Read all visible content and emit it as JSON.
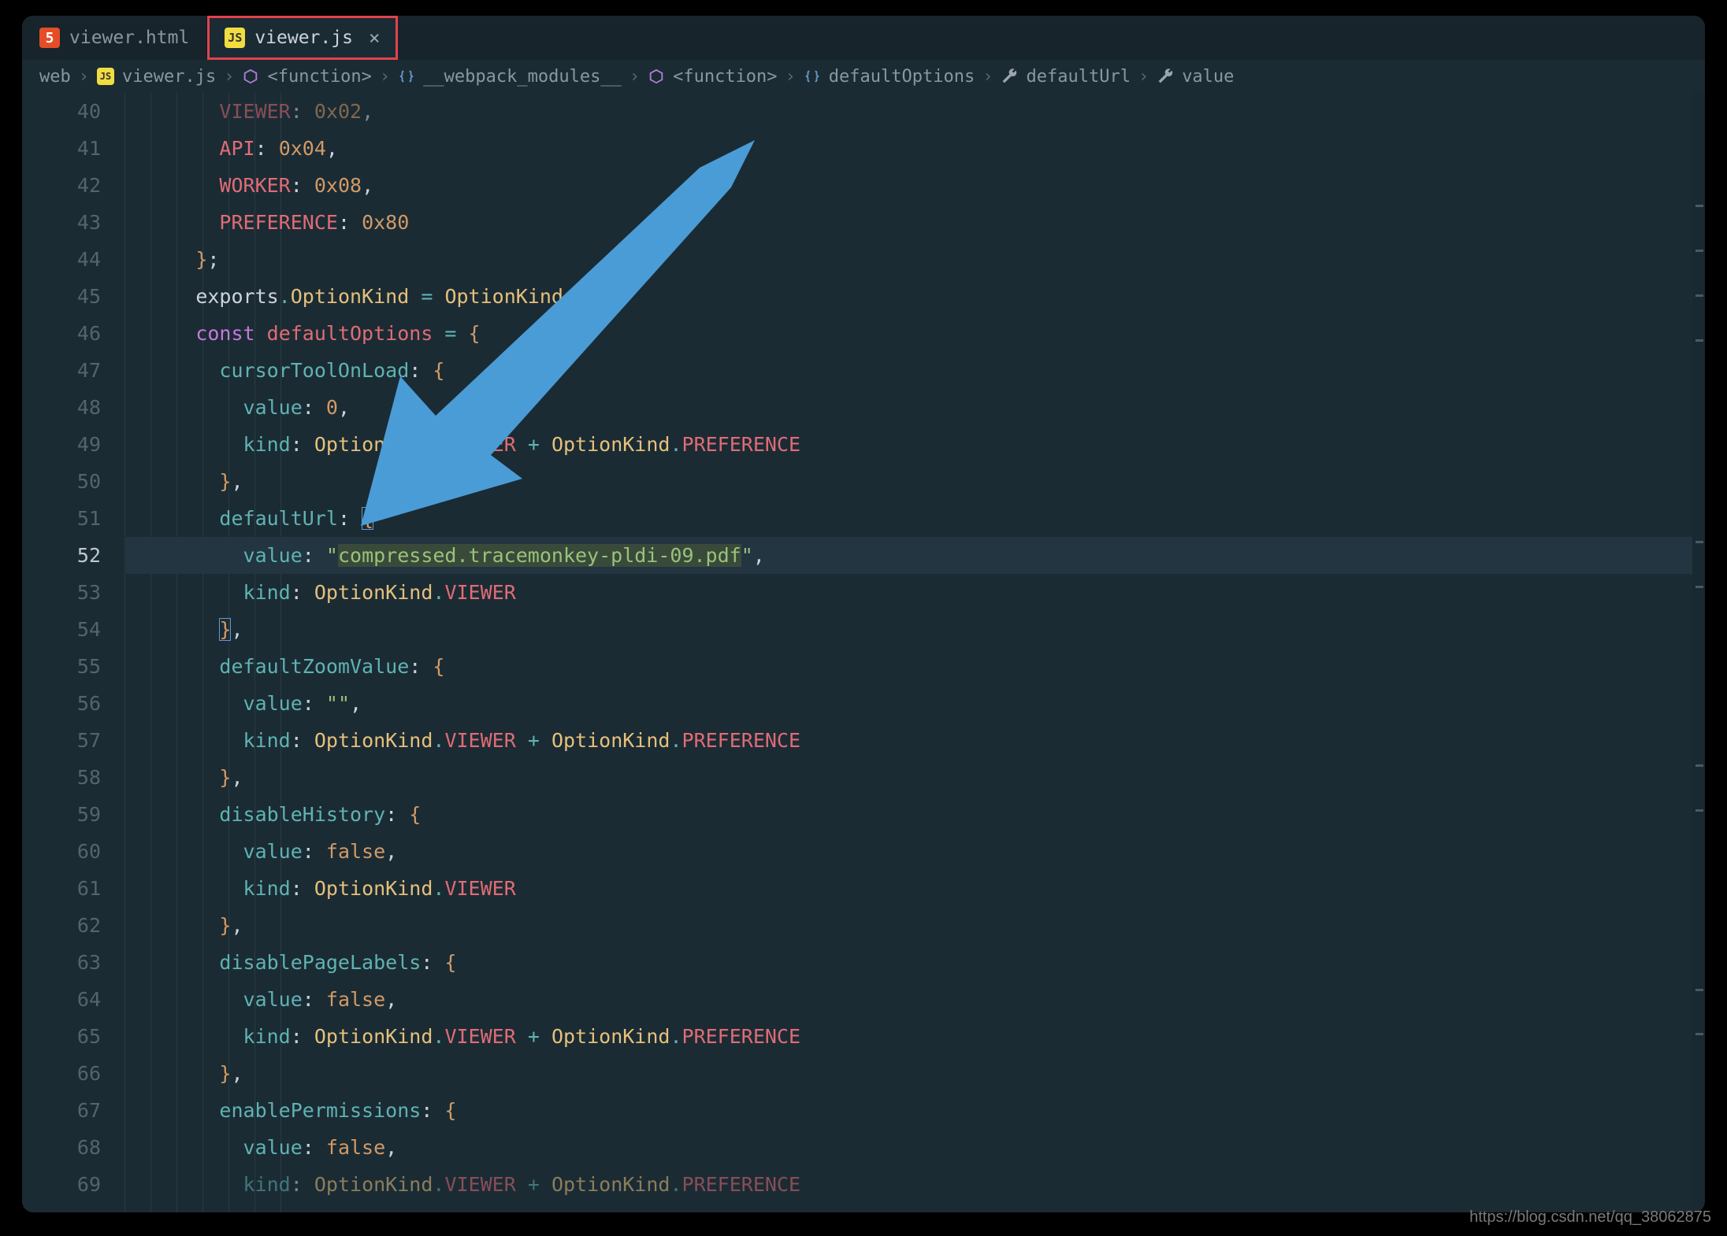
{
  "tabs": [
    {
      "icon": "html",
      "iconText": "5",
      "label": "viewer.html",
      "active": false,
      "close": false
    },
    {
      "icon": "js",
      "iconText": "JS",
      "label": "viewer.js",
      "active": true,
      "close": true
    }
  ],
  "breadcrumb": {
    "items": [
      {
        "icon": "",
        "text": "web"
      },
      {
        "icon": "js",
        "text": "viewer.js"
      },
      {
        "icon": "cube",
        "text": "<function>"
      },
      {
        "icon": "braces",
        "text": "__webpack_modules__"
      },
      {
        "icon": "cube",
        "text": "<function>"
      },
      {
        "icon": "braces",
        "text": "defaultOptions"
      },
      {
        "icon": "wrench",
        "text": "defaultUrl"
      },
      {
        "icon": "wrench",
        "text": "value"
      }
    ],
    "sep": "›"
  },
  "gutter": {
    "start": 40,
    "end": 69,
    "current": 52
  },
  "code": {
    "40": "        VIEWER: 0x02,",
    "41": "        API: 0x04,",
    "42": "        WORKER: 0x08,",
    "43": "        PREFERENCE: 0x80",
    "44": "      };",
    "45": "      exports.OptionKind = OptionKind;",
    "46": "      const defaultOptions = {",
    "47": "        cursorToolOnLoad: {",
    "48": "          value: 0,",
    "49": "          kind: OptionKind.VIEWER + OptionKind.PREFERENCE",
    "50": "        },",
    "51": "        defaultUrl: {",
    "52": "          value: \"compressed.tracemonkey-pldi-09.pdf\",",
    "53": "          kind: OptionKind.VIEWER",
    "54": "        },",
    "55": "        defaultZoomValue: {",
    "56": "          value: \"\",",
    "57": "          kind: OptionKind.VIEWER + OptionKind.PREFERENCE",
    "58": "        },",
    "59": "        disableHistory: {",
    "60": "          value: false,",
    "61": "          kind: OptionKind.VIEWER",
    "62": "        },",
    "63": "        disablePageLabels: {",
    "64": "          value: false,",
    "65": "          kind: OptionKind.VIEWER + OptionKind.PREFERENCE",
    "66": "        },",
    "67": "        enablePermissions: {",
    "68": "          value: false,",
    "69": "          kind: OptionKind.VIEWER + OptionKind.PREFERENCE"
  },
  "tokens": {
    "VIEWER": "c-memb",
    "API": "c-memb",
    "WORKER": "c-memb",
    "PREFERENCE": "c-memb",
    "value": "c-prop",
    "kind": "c-prop",
    "OptionKind": "c-obj",
    "exports": "c-exp",
    "const": "c-key",
    "defaultOptions": "c-memb",
    "cursorToolOnLoad": "c-prop",
    "defaultUrl": "c-prop",
    "defaultZoomValue": "c-prop",
    "disableHistory": "c-prop",
    "disablePageLabels": "c-prop",
    "enablePermissions": "c-prop",
    "false": "c-bool",
    "0": "c-num",
    "0x02": "c-num",
    "0x04": "c-num",
    "0x08": "c-num",
    "0x80": "c-num"
  },
  "highlightedString": "compressed.tracemonkey-pldi-09.pdf",
  "watermark": "https://blog.csdn.net/qq_38062875"
}
